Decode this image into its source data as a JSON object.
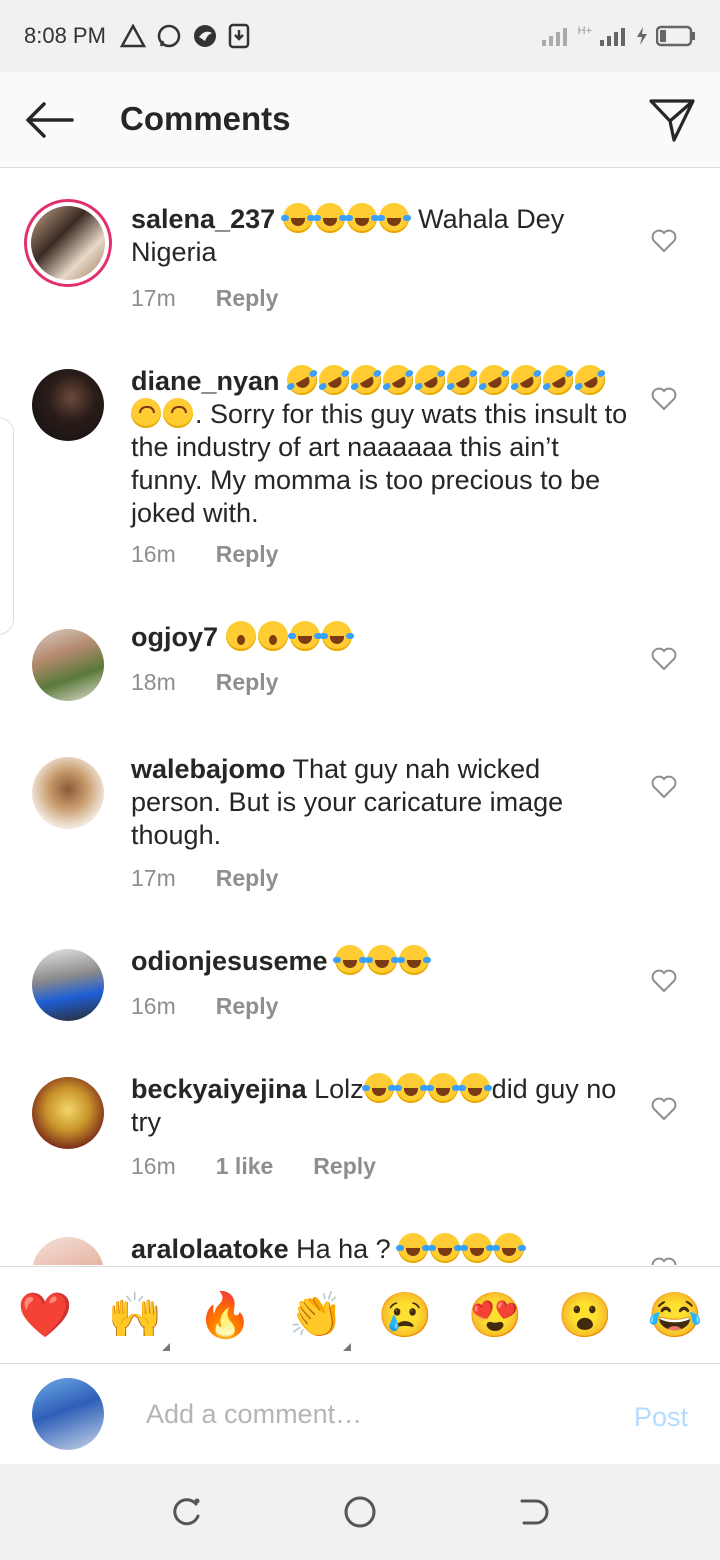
{
  "status_bar": {
    "time": "8:08 PM",
    "notification_icons": [
      "warning-icon",
      "whatsapp-icon",
      "bird-app-icon",
      "download-icon"
    ],
    "network": "H+",
    "charging": true
  },
  "header": {
    "title": "Comments",
    "back_icon": "back-arrow-icon",
    "share_icon": "direct-send-icon"
  },
  "comments": [
    {
      "username": "salena_237",
      "text_emojis": [
        "joy",
        "joy",
        "joy",
        "joy"
      ],
      "text": " Wahala Dey Nigeria",
      "time": "17m",
      "likes": "",
      "reply": "Reply",
      "story_ring": true
    },
    {
      "username": "diane_nyan",
      "text_emojis": [
        "rofl",
        "rofl",
        "rofl",
        "rofl",
        "rofl",
        "rofl",
        "rofl",
        "rofl",
        "rofl",
        "rofl",
        "upside-down",
        "upside-down"
      ],
      "text": ". Sorry for this guy wats this insult to the industry of art naaaaaa this ain’t funny. My momma is too precious to be joked with.",
      "time": "16m",
      "likes": "",
      "reply": "Reply"
    },
    {
      "username": "ogjoy7",
      "text_emojis": [
        "open-mouth",
        "open-mouth",
        "joy",
        "joy"
      ],
      "text": "",
      "time": "18m",
      "likes": "",
      "reply": "Reply"
    },
    {
      "username": "walebajomo",
      "text_emojis": [],
      "text": " That guy nah wicked person.  But is your caricature image though.",
      "time": "17m",
      "likes": "",
      "reply": "Reply"
    },
    {
      "username": "odionjesuseme",
      "text_emojis": [
        "joy",
        "joy",
        "joy"
      ],
      "text": "",
      "time": "16m",
      "likes": "",
      "reply": "Reply"
    },
    {
      "username": "beckyaiyejina",
      "text_prefix": " Lolz",
      "text_emojis": [
        "joy",
        "joy",
        "joy",
        "joy"
      ],
      "text": "did guy no try",
      "time": "16m",
      "likes": "1 like",
      "reply": "Reply"
    },
    {
      "username": "aralolaatoke",
      "text_prefix": " Ha ha ? ",
      "text_emojis": [
        "joy",
        "joy",
        "joy",
        "joy"
      ],
      "text": "",
      "time": "",
      "likes": "",
      "reply": ""
    }
  ],
  "quick_reactions": [
    "❤️",
    "🙌",
    "🔥",
    "👏",
    "😢",
    "😍",
    "😮",
    "😂"
  ],
  "composer": {
    "placeholder": "Add a comment…",
    "post_label": "Post"
  },
  "nav_bar": {
    "buttons": [
      "recents-icon",
      "home-icon",
      "back-icon"
    ]
  }
}
